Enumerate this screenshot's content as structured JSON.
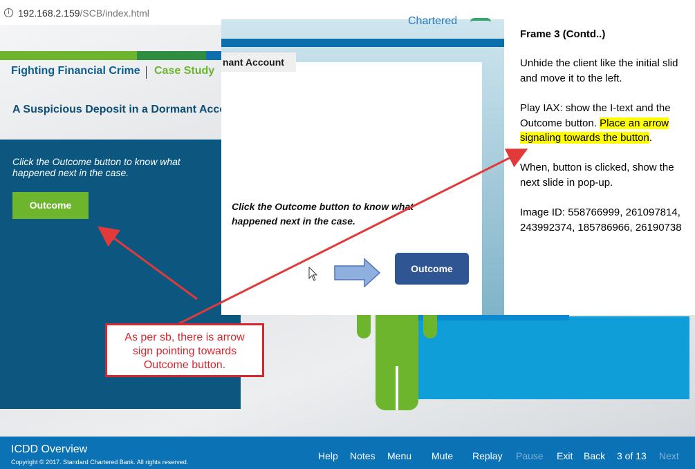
{
  "browser": {
    "info_icon": "info-icon",
    "url_host": "192.168.2.159",
    "url_path": "/SCB/index.html"
  },
  "course": {
    "header_title": "Fighting Financial Crime",
    "header_case": "Case Study",
    "scene_title": "A Suspicious Deposit in a Dormant Acco",
    "instruction": "Click the Outcome button to know what happened next in the case.",
    "outcome_button": "Outcome"
  },
  "storyboard": {
    "logo_text": "Chartered",
    "label": "nant Account",
    "instruction": "Click the Outcome button to know what happened next in the case.",
    "outcome_button": "Outcome",
    "arrow_icon": "right-arrow-icon",
    "cursor_icon": "mouse-cursor-icon"
  },
  "notes": {
    "title": "Frame 3 (Contd..)",
    "p1_line1": "Unhide the client like the initial slid",
    "p1_line2": "and move it to the left.",
    "p2_line1": "Play IAX: show the I-text and the",
    "p2_line2_plain": "Outcome button. ",
    "p2_line2_hl": "Place an arrow",
    "p2_line3_hl": "signaling towards the button",
    "p2_line3_end": ".",
    "p3_line1": "When, button is clicked, show the",
    "p3_line2": "next slide in pop-up.",
    "p4_line1": "Image ID: 558766999, 261097814,",
    "p4_line2": "243992374, 185786966, 26190738"
  },
  "callout": {
    "line1": "As per sb, there is arrow",
    "line2": "sign pointing towards",
    "line3": "Outcome button."
  },
  "footer": {
    "title": "ICDD Overview",
    "copyright": "Copyright © 2017. Standard Chartered Bank. All rights reserved.",
    "help": "Help",
    "notes": "Notes",
    "menu": "Menu",
    "mute": "Mute",
    "replay": "Replay",
    "pause": "Pause",
    "exit": "Exit",
    "back": "Back",
    "page": "3 of 13",
    "next": "Next"
  },
  "colors": {
    "brand_green": "#6cb52d",
    "brand_blue": "#0b72b5",
    "panel_blue": "#0b5780",
    "annotation_red": "#d8262c",
    "highlight_yellow": "#ffff00"
  }
}
